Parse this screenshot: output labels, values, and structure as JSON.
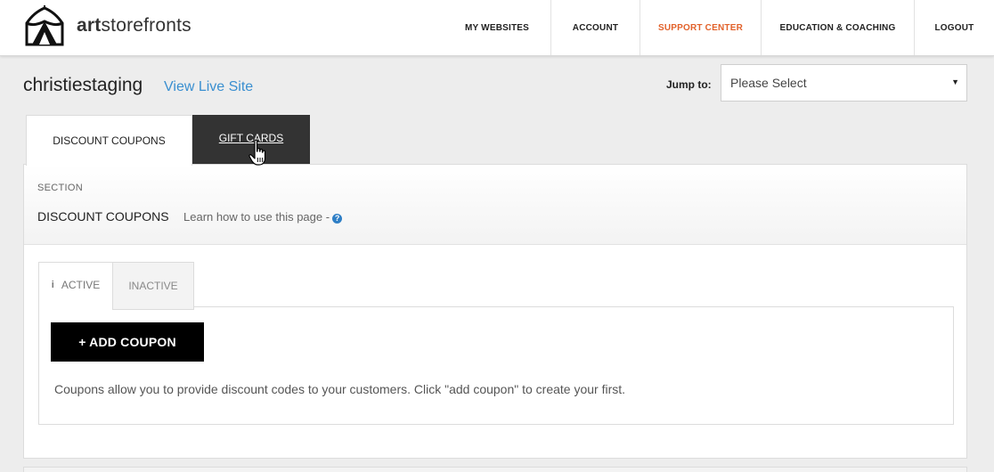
{
  "header": {
    "logo_bold": "art",
    "logo_rest": "storefronts",
    "nav": [
      {
        "label": "MY WEBSITES"
      },
      {
        "label": "ACCOUNT"
      },
      {
        "label": "SUPPORT CENTER"
      },
      {
        "label": "EDUCATION & COACHING"
      },
      {
        "label": "LOGOUT"
      }
    ]
  },
  "site": {
    "name": "christiestaging",
    "view_live": "View Live Site",
    "jump_label": "Jump to:",
    "jump_value": "Please Select"
  },
  "tabs": {
    "discount": "DISCOUNT COUPONS",
    "gift": "GIFT CARDS"
  },
  "section": {
    "label": "SECTION",
    "title": "DISCOUNT COUPONS",
    "learn": "Learn how to use this page -"
  },
  "coupon_tabs": {
    "active": "ACTIVE",
    "inactive": "INACTIVE"
  },
  "coupons": {
    "add_label": "+ ADD COUPON",
    "empty_text": "Coupons allow you to provide discount codes to your customers. Click \"add coupon\" to create your first."
  },
  "colors": {
    "accent": "#e2622b",
    "link": "#3a8fd0",
    "dark_tab": "#333333"
  }
}
